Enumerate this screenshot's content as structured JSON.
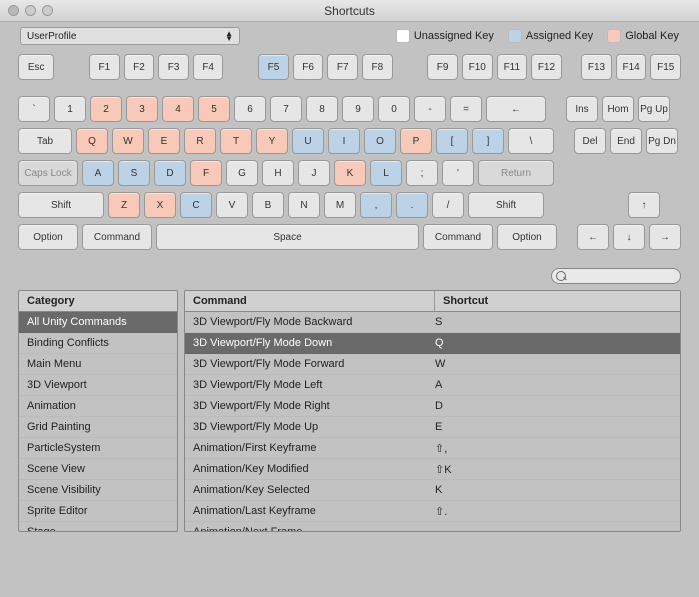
{
  "window": {
    "title": "Shortcuts"
  },
  "profile": {
    "selected": "UserProfile"
  },
  "legend": {
    "unassigned": "Unassigned Key",
    "assigned": "Assigned Key",
    "global": "Global Key"
  },
  "keyboard": {
    "r1": [
      {
        "l": "Esc",
        "c": "",
        "w": "w38"
      },
      {
        "gap": "gap2"
      },
      {
        "l": "F1",
        "c": "",
        "w": "w32"
      },
      {
        "l": "F2",
        "c": "",
        "w": "w32"
      },
      {
        "l": "F3",
        "c": "",
        "w": "w32"
      },
      {
        "l": "F4",
        "c": "",
        "w": "w32"
      },
      {
        "gap": "gap2"
      },
      {
        "l": "F5",
        "c": "blue",
        "w": "w32"
      },
      {
        "l": "F6",
        "c": "",
        "w": "w32"
      },
      {
        "l": "F7",
        "c": "",
        "w": "w32"
      },
      {
        "l": "F8",
        "c": "",
        "w": "w32"
      },
      {
        "gap": "gap2"
      },
      {
        "l": "F9",
        "c": "",
        "w": "w32"
      },
      {
        "l": "F10",
        "c": "",
        "w": "w32"
      },
      {
        "l": "F11",
        "c": "",
        "w": "w32"
      },
      {
        "l": "F12",
        "c": "",
        "w": "w32"
      },
      {
        "gap": "gap"
      },
      {
        "l": "F13",
        "c": "",
        "w": "w32"
      },
      {
        "l": "F14",
        "c": "",
        "w": "w32"
      },
      {
        "l": "F15",
        "c": "",
        "w": "w32"
      }
    ],
    "r2": [
      {
        "l": "`",
        "c": "",
        "w": "w32"
      },
      {
        "l": "1",
        "c": "",
        "w": "w32"
      },
      {
        "l": "2",
        "c": "orange",
        "w": "w32"
      },
      {
        "l": "3",
        "c": "orange",
        "w": "w32"
      },
      {
        "l": "4",
        "c": "orange",
        "w": "w32"
      },
      {
        "l": "5",
        "c": "orange",
        "w": "w32"
      },
      {
        "l": "6",
        "c": "",
        "w": "w32"
      },
      {
        "l": "7",
        "c": "",
        "w": "w32"
      },
      {
        "l": "8",
        "c": "",
        "w": "w32"
      },
      {
        "l": "9",
        "c": "",
        "w": "w32"
      },
      {
        "l": "0",
        "c": "",
        "w": "w32"
      },
      {
        "l": "-",
        "c": "",
        "w": "w32"
      },
      {
        "l": "=",
        "c": "",
        "w": "w32"
      },
      {
        "l": "←",
        "c": "",
        "w": "w60"
      },
      {
        "gap": "gap"
      },
      {
        "l": "Ins",
        "c": "",
        "w": "w32"
      },
      {
        "l": "Hom",
        "c": "",
        "w": "w32"
      },
      {
        "l": "Pg Up",
        "c": "",
        "w": "w32"
      }
    ],
    "r3": [
      {
        "l": "Tab",
        "c": "",
        "w": "w54"
      },
      {
        "l": "Q",
        "c": "orange",
        "w": "w32"
      },
      {
        "l": "W",
        "c": "orange",
        "w": "w32"
      },
      {
        "l": "E",
        "c": "orange",
        "w": "w32"
      },
      {
        "l": "R",
        "c": "orange",
        "w": "w32"
      },
      {
        "l": "T",
        "c": "orange",
        "w": "w32"
      },
      {
        "l": "Y",
        "c": "orange",
        "w": "w32"
      },
      {
        "l": "U",
        "c": "blue",
        "w": "w32"
      },
      {
        "l": "I",
        "c": "blue",
        "w": "w32"
      },
      {
        "l": "O",
        "c": "blue",
        "w": "w32"
      },
      {
        "l": "P",
        "c": "orange",
        "w": "w32"
      },
      {
        "l": "[",
        "c": "blue",
        "w": "w32"
      },
      {
        "l": "]",
        "c": "blue",
        "w": "w32"
      },
      {
        "l": "\\",
        "c": "",
        "w": "w46"
      },
      {
        "gap": "gap"
      },
      {
        "l": "Del",
        "c": "",
        "w": "w32"
      },
      {
        "l": "End",
        "c": "",
        "w": "w32"
      },
      {
        "l": "Pg Dn",
        "c": "",
        "w": "w32"
      }
    ],
    "r4": [
      {
        "l": "Caps Lock",
        "c": "gray",
        "w": "w60"
      },
      {
        "l": "A",
        "c": "blue",
        "w": "w32"
      },
      {
        "l": "S",
        "c": "blue",
        "w": "w32"
      },
      {
        "l": "D",
        "c": "blue",
        "w": "w32"
      },
      {
        "l": "F",
        "c": "orange",
        "w": "w32"
      },
      {
        "l": "G",
        "c": "",
        "w": "w32"
      },
      {
        "l": "H",
        "c": "",
        "w": "w32"
      },
      {
        "l": "J",
        "c": "",
        "w": "w32"
      },
      {
        "l": "K",
        "c": "orange",
        "w": "w32"
      },
      {
        "l": "L",
        "c": "blue",
        "w": "w32"
      },
      {
        "l": ";",
        "c": "",
        "w": "w32"
      },
      {
        "l": "'",
        "c": "",
        "w": "w32"
      },
      {
        "l": "Return",
        "c": "gray",
        "w": "w76"
      }
    ],
    "r5": [
      {
        "l": "Shift",
        "c": "",
        "w": "w86"
      },
      {
        "l": "Z",
        "c": "orange",
        "w": "w32"
      },
      {
        "l": "X",
        "c": "orange",
        "w": "w32"
      },
      {
        "l": "C",
        "c": "blue",
        "w": "w32"
      },
      {
        "l": "V",
        "c": "",
        "w": "w32"
      },
      {
        "l": "B",
        "c": "",
        "w": "w32"
      },
      {
        "l": "N",
        "c": "",
        "w": "w32"
      },
      {
        "l": "M",
        "c": "",
        "w": "w32"
      },
      {
        "l": ",",
        "c": "blue",
        "w": "w32"
      },
      {
        "l": ".",
        "c": "blue",
        "w": "w32"
      },
      {
        "l": "/",
        "c": "",
        "w": "w32"
      },
      {
        "l": "Shift",
        "c": "",
        "w": "w76"
      },
      {
        "gap": "gap2"
      },
      {
        "gap": "gap2"
      },
      {
        "gap": "gap"
      },
      {
        "l": "↑",
        "c": "",
        "w": "w32"
      }
    ],
    "r6": [
      {
        "l": "Option",
        "c": "",
        "w": "w60"
      },
      {
        "l": "Command",
        "c": "",
        "w": "w70"
      },
      {
        "l": "Space",
        "c": "",
        "w": "wspace"
      },
      {
        "l": "Command",
        "c": "",
        "w": "w70"
      },
      {
        "l": "Option",
        "c": "",
        "w": "w60"
      },
      {
        "gap": "gap"
      },
      {
        "l": "←",
        "c": "",
        "w": "w32"
      },
      {
        "l": "↓",
        "c": "",
        "w": "w32"
      },
      {
        "l": "→",
        "c": "",
        "w": "w32"
      }
    ]
  },
  "categories": {
    "header": "Category",
    "items": [
      {
        "label": "All Unity Commands",
        "sel": true
      },
      {
        "label": "Binding Conflicts"
      },
      {
        "label": "Main Menu"
      },
      {
        "label": "3D Viewport"
      },
      {
        "label": "Animation"
      },
      {
        "label": "Grid Painting"
      },
      {
        "label": "ParticleSystem"
      },
      {
        "label": "Scene View"
      },
      {
        "label": "Scene Visibility"
      },
      {
        "label": "Sprite Editor"
      },
      {
        "label": "Stage"
      }
    ]
  },
  "commands": {
    "header_cmd": "Command",
    "header_sc": "Shortcut",
    "items": [
      {
        "cmd": "3D Viewport/Fly Mode Backward",
        "sc": "S"
      },
      {
        "cmd": "3D Viewport/Fly Mode Down",
        "sc": "Q",
        "sel": true
      },
      {
        "cmd": "3D Viewport/Fly Mode Forward",
        "sc": "W"
      },
      {
        "cmd": "3D Viewport/Fly Mode Left",
        "sc": "A"
      },
      {
        "cmd": "3D Viewport/Fly Mode Right",
        "sc": "D"
      },
      {
        "cmd": "3D Viewport/Fly Mode Up",
        "sc": "E"
      },
      {
        "cmd": "Animation/First Keyframe",
        "sc": "⇧,"
      },
      {
        "cmd": "Animation/Key Modified",
        "sc": "⇧K"
      },
      {
        "cmd": "Animation/Key Selected",
        "sc": "K"
      },
      {
        "cmd": "Animation/Last Keyframe",
        "sc": "⇧."
      },
      {
        "cmd": "Animation/Next Frame",
        "sc": "."
      }
    ]
  }
}
